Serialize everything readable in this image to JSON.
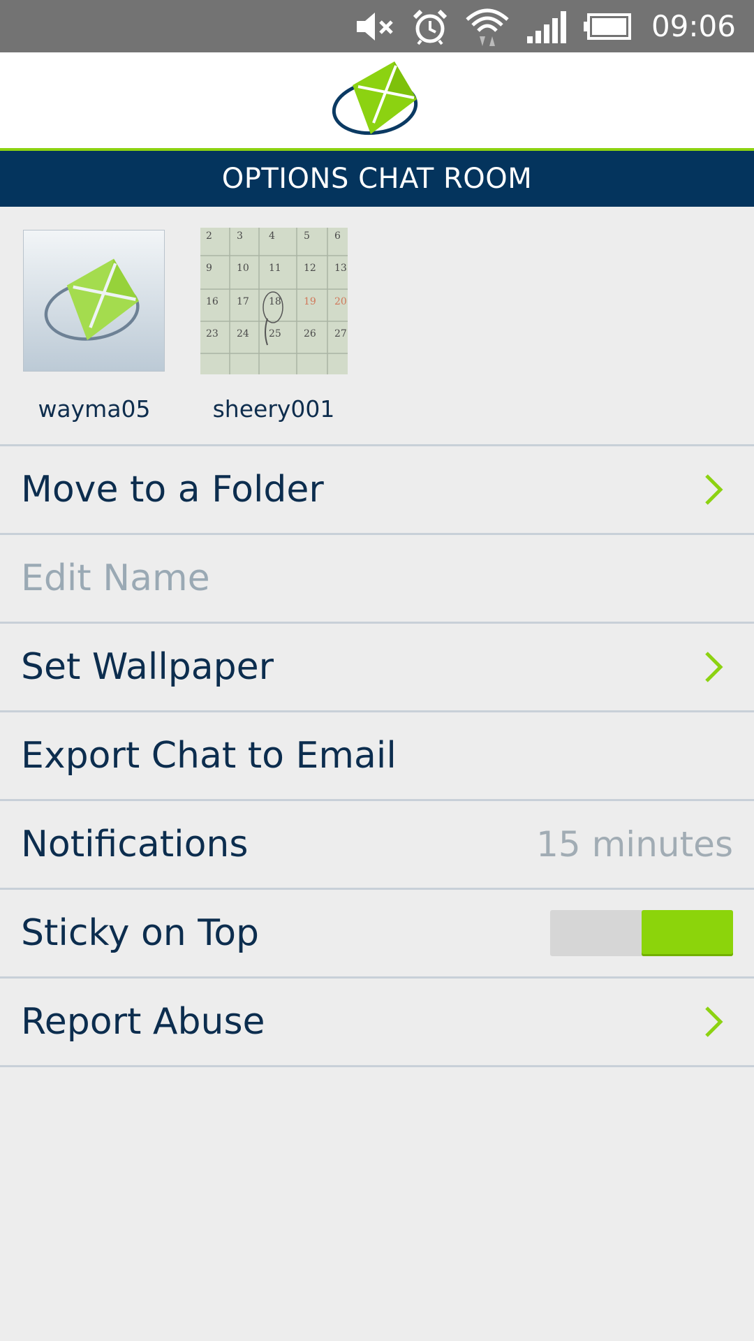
{
  "status_bar": {
    "time": "09:06",
    "icons": [
      "mute-icon",
      "alarm-icon",
      "wifi-icon",
      "signal-icon",
      "battery-icon"
    ]
  },
  "header": {
    "title": "OPTIONS CHAT ROOM",
    "accent_color": "#8cd211",
    "title_bar_color": "#04345d"
  },
  "members": [
    {
      "name": "wayma05",
      "avatar": "kite-logo-avatar"
    },
    {
      "name": "sheery001",
      "avatar": "calendar-photo-avatar"
    }
  ],
  "calendar_photo": {
    "rows": [
      [
        "2",
        "3",
        "4",
        "5",
        "6"
      ],
      [
        "9",
        "10",
        "11",
        "12",
        "13"
      ],
      [
        "16",
        "17",
        "18",
        "19",
        "20"
      ],
      [
        "23",
        "24",
        "25",
        "26",
        "27"
      ]
    ]
  },
  "menu": {
    "items": [
      {
        "label": "Move to a Folder",
        "right": "chevron"
      },
      {
        "label": "Edit Name",
        "right": "none",
        "disabled": true
      },
      {
        "label": "Set Wallpaper",
        "right": "chevron"
      },
      {
        "label": "Export Chat to Email",
        "right": "none"
      },
      {
        "label": "Notifications",
        "right": "value",
        "value": "15 minutes"
      },
      {
        "label": "Sticky on Top",
        "right": "toggle",
        "toggle_on": true
      },
      {
        "label": "Report Abuse",
        "right": "chevron"
      }
    ]
  }
}
